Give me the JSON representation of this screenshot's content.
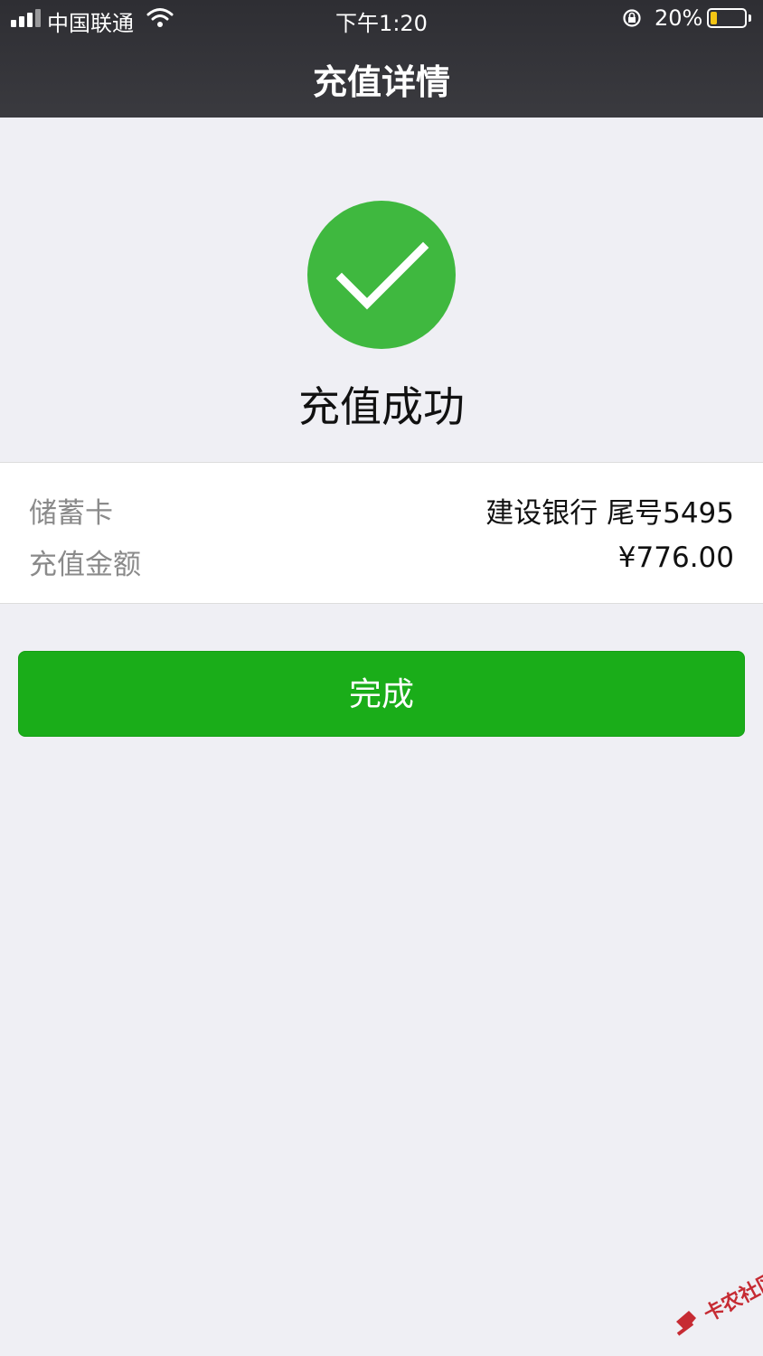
{
  "status_bar": {
    "carrier": "中国联通",
    "time": "下午1:20",
    "battery_percent": "20%",
    "battery_level": 0.2,
    "battery_color": "#f4c514"
  },
  "nav": {
    "title": "充值详情"
  },
  "result": {
    "icon": "checkmark-circle-icon",
    "color": "#3fb83f",
    "text": "充值成功"
  },
  "details": {
    "card_label": "储蓄卡",
    "card_value": "建设银行 尾号5495",
    "amount_label": "充值金额",
    "amount_value": "¥776.00"
  },
  "done_button": {
    "label": "完成",
    "color": "#1aad19"
  },
  "watermark": {
    "text": "卡农社区"
  }
}
